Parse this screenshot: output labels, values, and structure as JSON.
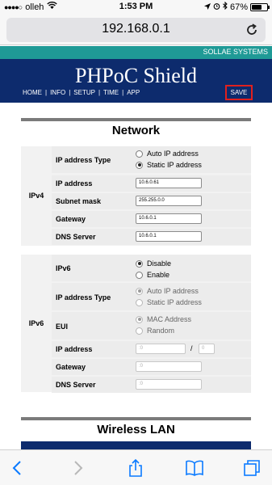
{
  "status_bar": {
    "carrier": "olleh",
    "time": "1:53 PM",
    "battery": "67%",
    "battery_level": 0.67
  },
  "browser": {
    "url": "192.168.0.1"
  },
  "header": {
    "vendor": "SOLLAE SYSTEMS",
    "title": "PHPoC Shield",
    "nav": [
      "HOME",
      "INFO",
      "SETUP",
      "TIME",
      "APP"
    ],
    "save_label": "SAVE"
  },
  "network": {
    "title": "Network",
    "ipv4": {
      "group_label": "IPv4",
      "ip_type_label": "IP address Type",
      "ip_type_options": [
        "Auto IP address",
        "Static IP address"
      ],
      "ip_type_selected": "Static IP address",
      "ip_address_label": "IP address",
      "ip_address": "10.6.0.61",
      "subnet_label": "Subnet mask",
      "subnet": "255.255.0.0",
      "gateway_label": "Gateway",
      "gateway": "10.6.0.1",
      "dns_label": "DNS Server",
      "dns": "10.6.0.1"
    },
    "ipv6": {
      "group_label": "IPv6",
      "ipv6_label": "IPv6",
      "ipv6_options": [
        "Disable",
        "Enable"
      ],
      "ipv6_selected": "Disable",
      "ip_type_label": "IP address Type",
      "ip_type_options": [
        "Auto IP address",
        "Static IP address"
      ],
      "eui_label": "EUI",
      "eui_options": [
        "MAC Address",
        "Random"
      ],
      "ip_address_label": "IP address",
      "ip_address": ":0",
      "prefix": "0",
      "prefix_separator": "/",
      "gateway_label": "Gateway",
      "gateway": ":0",
      "dns_label": "DNS Server",
      "dns": ":0"
    }
  },
  "wireless": {
    "title": "Wireless LAN"
  },
  "icons": {
    "reload": "reload-icon",
    "back": "back-arrow-icon",
    "forward": "forward-arrow-icon",
    "share": "share-icon",
    "bookmarks": "bookmarks-icon",
    "tabs": "tabs-icon"
  },
  "colors": {
    "vendor_bar": "#1f9a96",
    "brand_bar": "#0d2b6d",
    "save_highlight": "#e0201e",
    "ios_blue": "#0a7aff"
  }
}
